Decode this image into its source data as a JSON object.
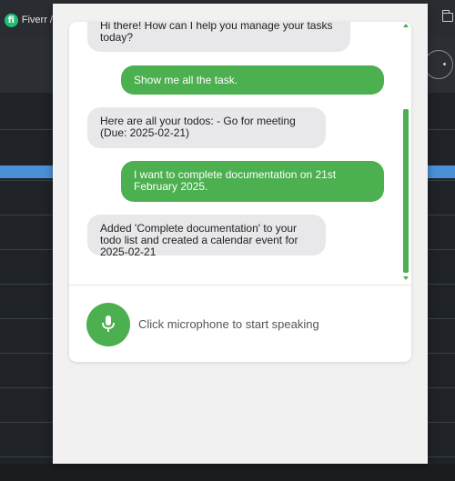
{
  "background": {
    "tab": {
      "logo_letter": "fi",
      "title": "Fiverr /"
    }
  },
  "chat": {
    "messages": [
      {
        "sender": "bot",
        "text": "Hi there! How can I help you manage your tasks today?"
      },
      {
        "sender": "user",
        "text": "Show me all the task."
      },
      {
        "sender": "bot",
        "text": "Here are all your todos: - Go for meeting (Due: 2025-02-21)"
      },
      {
        "sender": "user",
        "text": "I want to complete documentation on 21st February 2025."
      },
      {
        "sender": "bot",
        "text": "Added 'Complete documentation' to your todo list and created a calendar event for 2025-02-21"
      }
    ]
  },
  "voice": {
    "prompt": "Click microphone to start speaking",
    "icon": "microphone-icon"
  },
  "colors": {
    "accent": "#4caf50",
    "bot_bubble": "#e8e8ea",
    "panel": "#f1f1f1"
  }
}
